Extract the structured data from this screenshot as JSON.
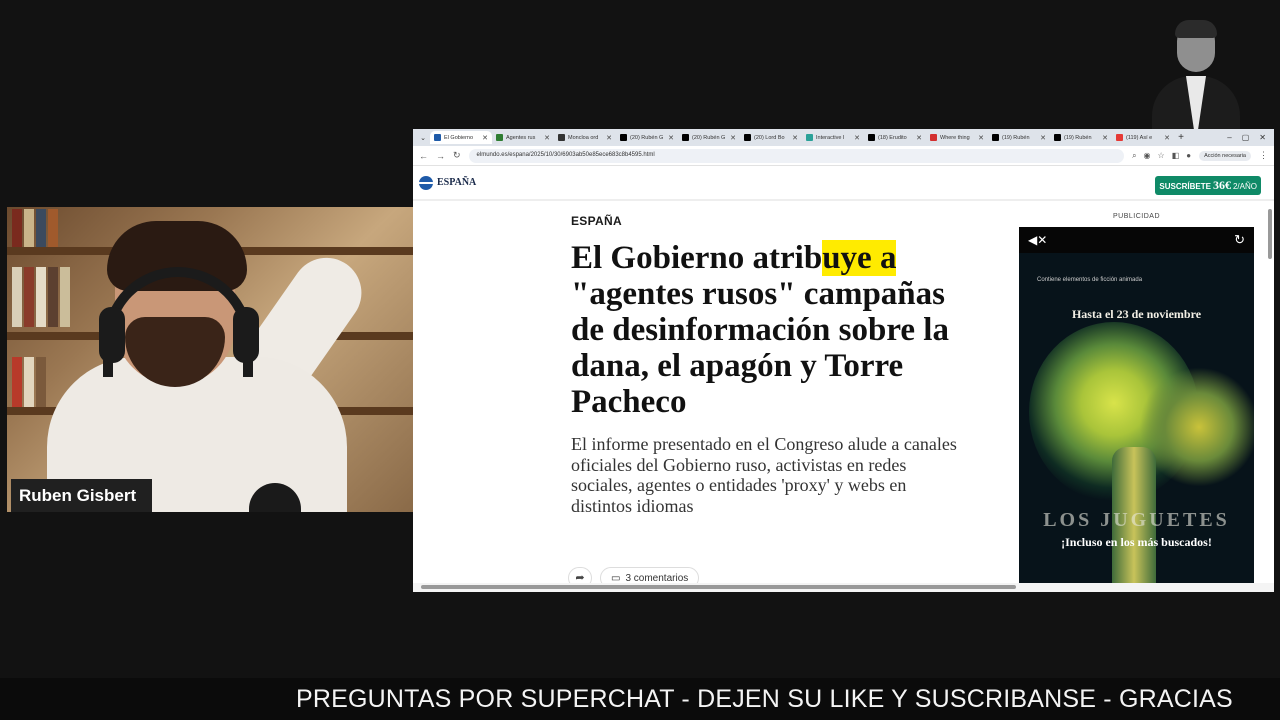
{
  "stream": {
    "presenter_name": "Ruben Gisbert",
    "ticker": "PREGUNTAS POR SUPERCHAT - DEJEN SU LIKE Y SUSCRIBANSE - GRACIAS"
  },
  "browser": {
    "tabs": [
      {
        "title": "El Gobierno",
        "active": true,
        "favicon_color": "#1e5aa8"
      },
      {
        "title": "Agentes rus",
        "favicon_color": "#2e7d32"
      },
      {
        "title": "Moncloa ord",
        "favicon_color": "#333333"
      },
      {
        "title": "(20) Rubén G",
        "favicon_color": "#000000"
      },
      {
        "title": "(20) Rubén G",
        "favicon_color": "#000000"
      },
      {
        "title": "(20) Lord Bo",
        "favicon_color": "#000000"
      },
      {
        "title": "Interactive I",
        "favicon_color": "#2aa198"
      },
      {
        "title": "(18) Erudito",
        "favicon_color": "#000000"
      },
      {
        "title": "Where thing",
        "favicon_color": "#d32f2f"
      },
      {
        "title": "(19) Rubén",
        "favicon_color": "#000000"
      },
      {
        "title": "(19) Rubén",
        "favicon_color": "#000000"
      },
      {
        "title": "(119) Así e",
        "favicon_color": "#e53935"
      }
    ],
    "url": "elmundo.es/espana/2025/10/30/6903ab50e85ece683c8b4595.html",
    "action_button": "Acción necesaria"
  },
  "site": {
    "section": "ESPAÑA",
    "subscribe": {
      "label": "SUSCRÍBETE",
      "price": "36€",
      "period": "2/AÑO"
    }
  },
  "article": {
    "kicker": "ESPAÑA",
    "headline_before": "El Gobierno atrib",
    "headline_highlight": "uye a",
    "headline_after": "\"agentes rusos\" campañas de desinformación sobre la dana, el apagón y Torre Pacheco",
    "standfirst": "El informe presentado en el Congreso alude a canales oficiales del Gobierno ruso, activistas en redes sociales, agentes o entidades 'proxy' y webs en distintos idiomas",
    "comments": "3 comentarios",
    "highlight_color": "#ffeb00"
  },
  "ad": {
    "label": "PUBLICIDAD",
    "note": "Contiene elementos de ficción animada",
    "date": "Hasta el 23 de noviembre",
    "brand": "LOS JUGUETES",
    "tagline": "¡Incluso en los más buscados!"
  }
}
